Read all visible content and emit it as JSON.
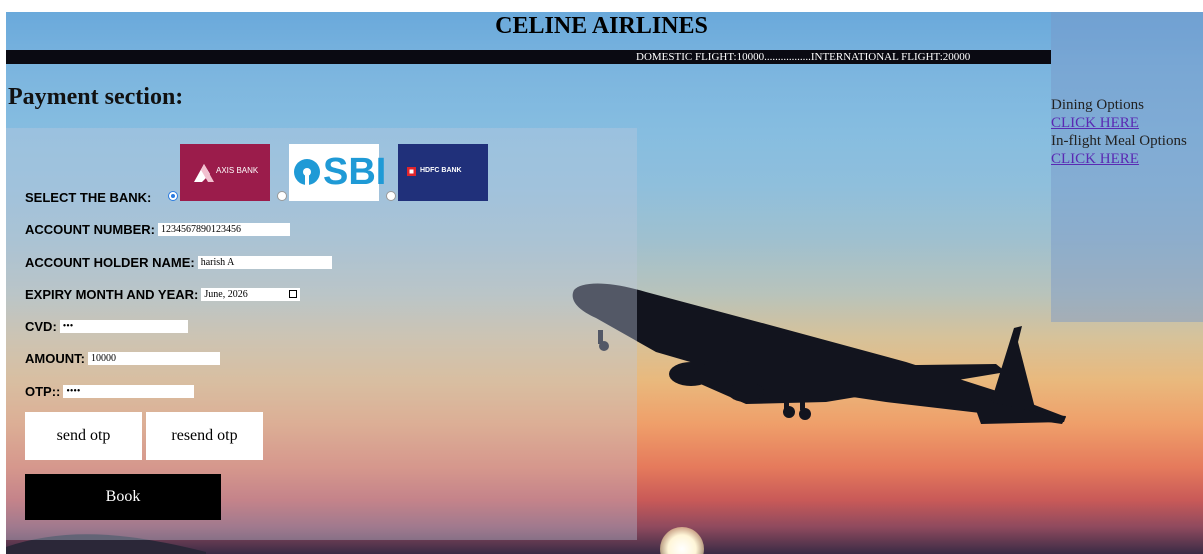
{
  "header": {
    "title": "CELINE AIRLINES",
    "prices": "DOMESTIC FLIGHT:10000.................INTERNATIONAL FLIGHT:20000"
  },
  "sidebar": {
    "dining_label": "Dining Options",
    "dining_link": "CLICK HERE",
    "meal_label": "In-flight Meal Options",
    "meal_link": "CLICK HERE"
  },
  "payment": {
    "heading": "Payment section:",
    "select_bank_label": "SELECT THE BANK:",
    "banks": [
      {
        "name": "AXIS BANK",
        "selected": true,
        "color": "#9b1c4b"
      },
      {
        "name": "SBI",
        "selected": false,
        "color": "#1f9ad6"
      },
      {
        "name": "HDFC BANK",
        "selected": false,
        "color": "#20307a"
      }
    ],
    "account_number_label": "ACCOUNT NUMBER:",
    "account_number_value": "1234567890123456",
    "holder_label": "ACCOUNT HOLDER NAME:",
    "holder_value": "harish A",
    "expiry_label": "EXPIRY MONTH AND YEAR:",
    "expiry_value": "June, 2026",
    "cvd_label": "CVD:",
    "cvd_value": "•••",
    "amount_label": "AMOUNT:",
    "amount_value": "10000",
    "otp_label": "OTP::",
    "otp_value": "••••",
    "send_otp": "send otp",
    "resend_otp": "resend otp",
    "book": "Book"
  }
}
